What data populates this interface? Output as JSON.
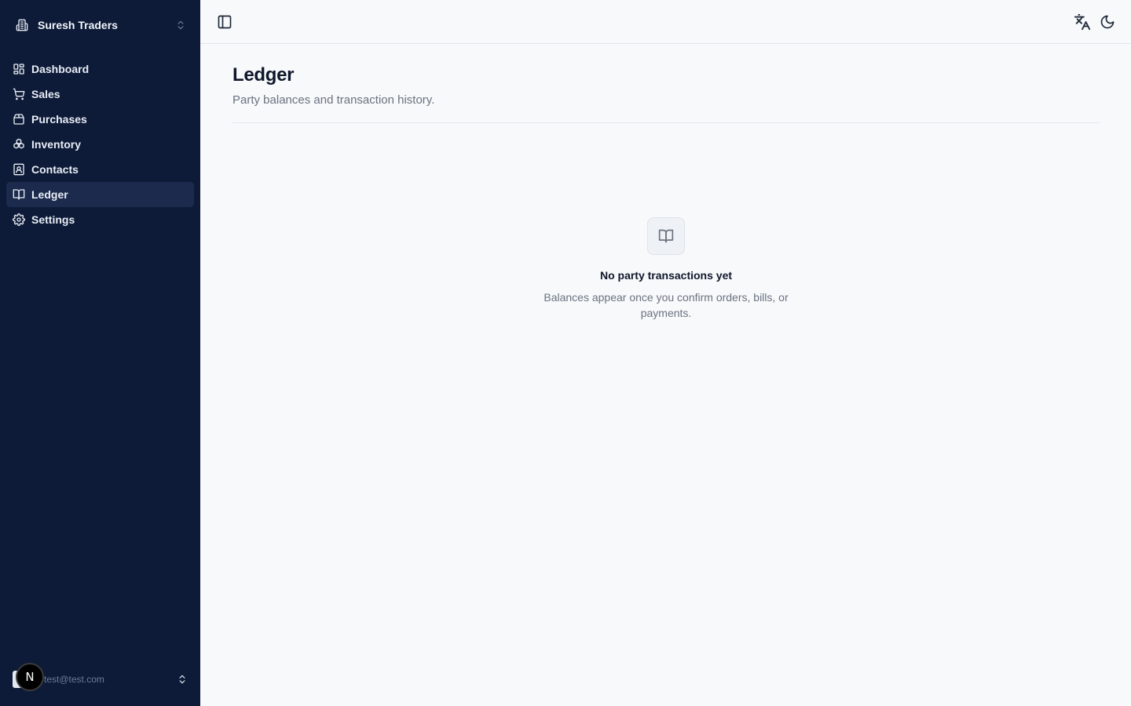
{
  "sidebar": {
    "org_name": "Suresh Traders",
    "items": [
      {
        "label": "Dashboard",
        "icon": "dashboard-grid-icon"
      },
      {
        "label": "Sales",
        "icon": "cart-icon"
      },
      {
        "label": "Purchases",
        "icon": "package-icon"
      },
      {
        "label": "Inventory",
        "icon": "boxes-icon"
      },
      {
        "label": "Contacts",
        "icon": "contact-card-icon"
      },
      {
        "label": "Ledger",
        "icon": "book-open-icon",
        "active": true
      },
      {
        "label": "Settings",
        "icon": "gear-icon"
      }
    ],
    "user_email": "test@test.com",
    "dev_badge": "N"
  },
  "topbar": {
    "toggle_icon": "sidebar-toggle-icon",
    "language_icon": "translate-icon",
    "theme_icon": "moon-icon"
  },
  "main": {
    "title": "Ledger",
    "subtitle": "Party balances and transaction history.",
    "empty_state": {
      "icon": "book-open-icon",
      "title": "No party transactions yet",
      "description": "Balances appear once you confirm orders, bills, or payments."
    }
  },
  "colors": {
    "sidebar_bg": "#0e1b38",
    "sidebar_active": "#1c2b4d",
    "page_bg": "#f7f9fb",
    "text_primary": "#0f172a",
    "text_muted": "#6b7280"
  }
}
